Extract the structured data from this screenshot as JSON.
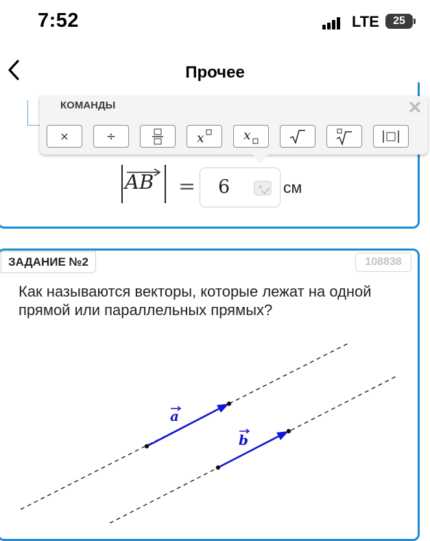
{
  "status_bar": {
    "time": "7:52",
    "network": "LTE",
    "battery": "25"
  },
  "nav": {
    "title": "Прочее",
    "back_icon": "chevron-left-icon"
  },
  "commands_popup": {
    "title": "КОМАНДЫ",
    "buttons": [
      "times",
      "divide",
      "fraction",
      "superscript",
      "subscript",
      "square-root",
      "nth-root",
      "absolute-value"
    ],
    "times_label": "×",
    "divide_label": "÷"
  },
  "task1": {
    "formula_vector": "AB",
    "equals": "=",
    "answer_value": "6",
    "unit": "см"
  },
  "task2": {
    "label": "ЗАДАНИЕ №2",
    "id": "108838",
    "question": "Как называются векторы, которые лежат на одной прямой или параллельных прямых?",
    "vector_a": "a",
    "vector_b": "b",
    "vector_color": "#1414d2"
  }
}
